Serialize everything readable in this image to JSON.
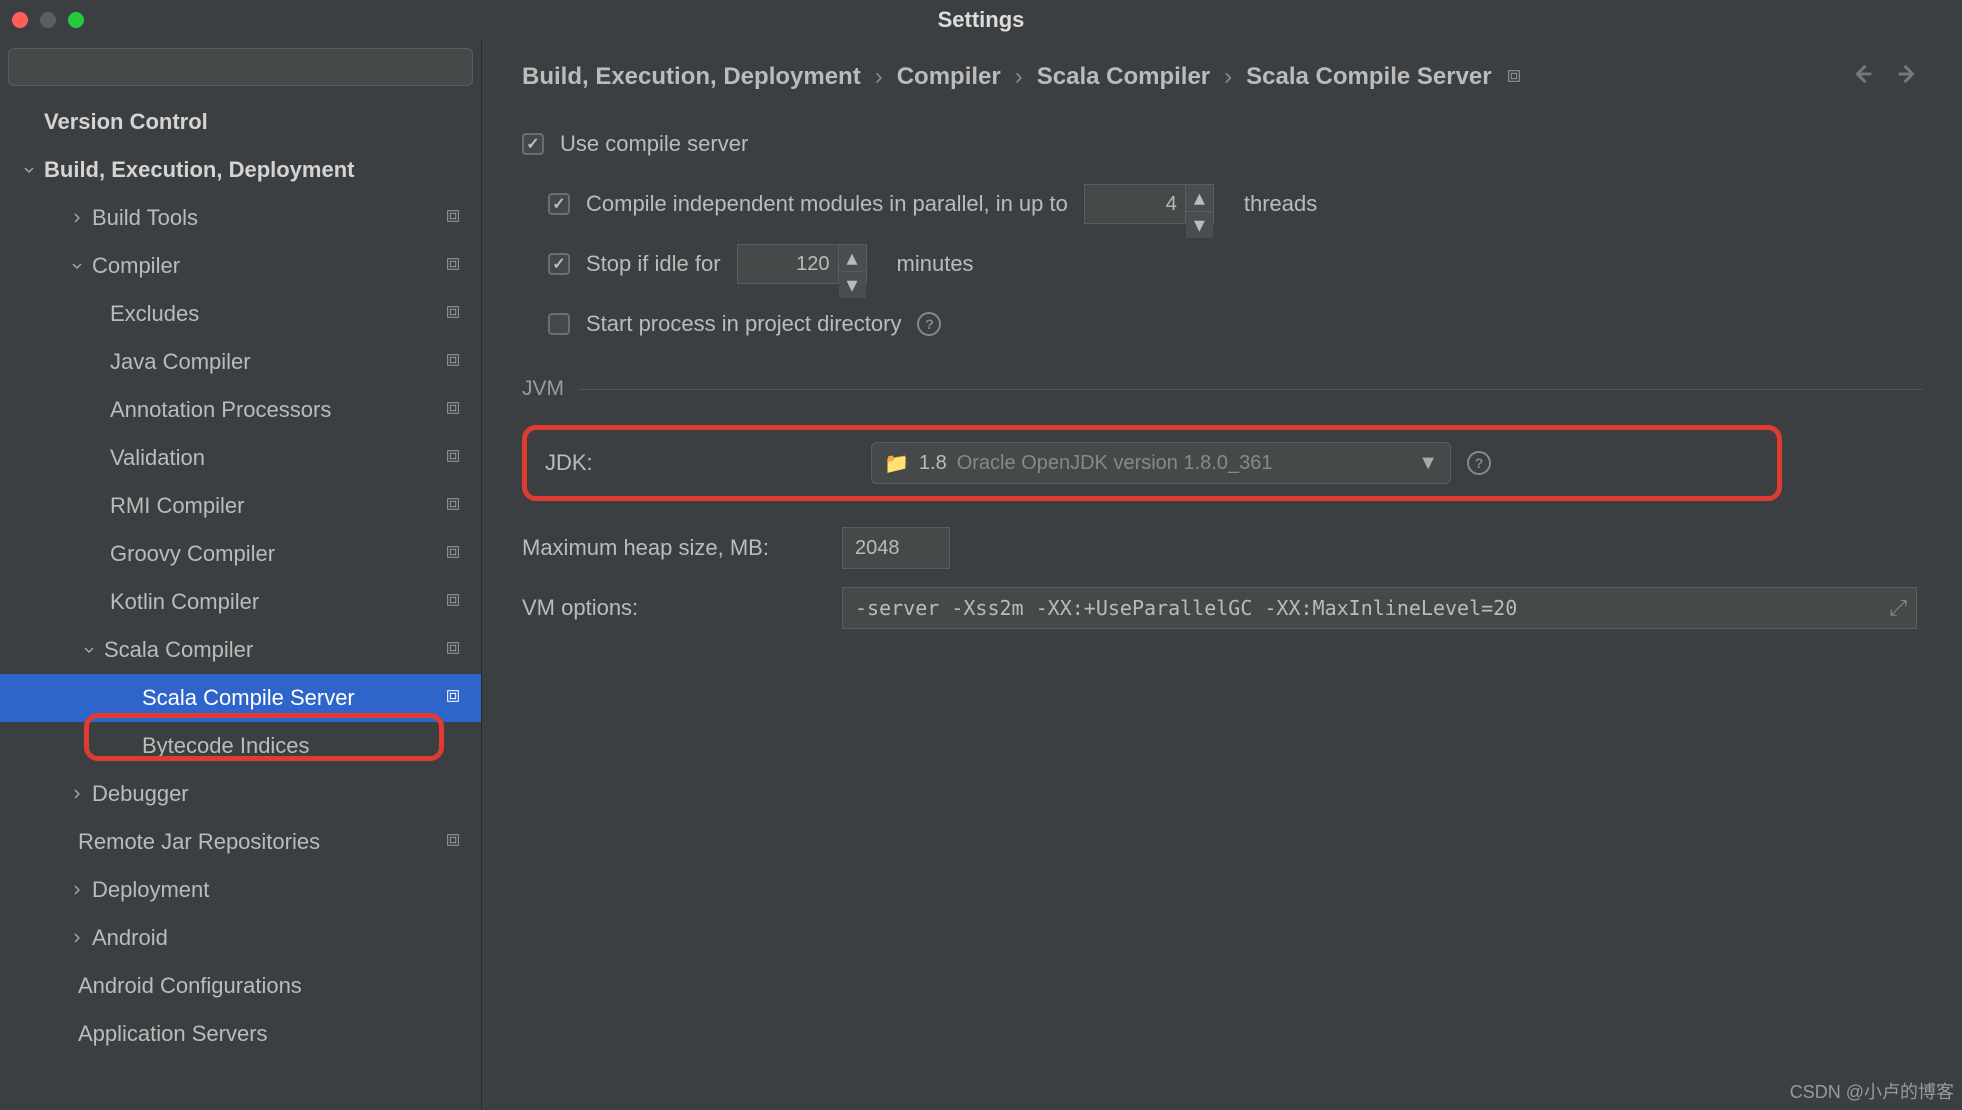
{
  "window": {
    "title": "Settings"
  },
  "search": {
    "placeholder": ""
  },
  "tree": {
    "version_control": "Version Control",
    "bed": "Build, Execution, Deployment",
    "build_tools": "Build Tools",
    "compiler": "Compiler",
    "excludes": "Excludes",
    "java_compiler": "Java Compiler",
    "annotation_processors": "Annotation Processors",
    "validation": "Validation",
    "rmi_compiler": "RMI Compiler",
    "groovy_compiler": "Groovy Compiler",
    "kotlin_compiler": "Kotlin Compiler",
    "scala_compiler": "Scala Compiler",
    "scala_compile_server": "Scala Compile Server",
    "bytecode_indices": "Bytecode Indices",
    "debugger": "Debugger",
    "remote_jar": "Remote Jar Repositories",
    "deployment": "Deployment",
    "android": "Android",
    "android_conf": "Android Configurations",
    "app_servers": "Application Servers"
  },
  "breadcrumb": {
    "a": "Build, Execution, Deployment",
    "b": "Compiler",
    "c": "Scala Compiler",
    "d": "Scala Compile Server"
  },
  "form": {
    "use_compile_server": "Use compile server",
    "parallel_label": "Compile independent modules in parallel, in up to",
    "parallel_value": "4",
    "threads": "threads",
    "stop_idle": "Stop if idle for",
    "stop_idle_value": "120",
    "minutes": "minutes",
    "start_in_project": "Start process in project directory",
    "jvm_section": "JVM",
    "jdk_label": "JDK:",
    "jdk_value": "1.8",
    "jdk_suffix": "Oracle OpenJDK version 1.8.0_361",
    "heap_label": "Maximum heap size, MB:",
    "heap_value": "2048",
    "vm_label": "VM options:",
    "vm_value": "-server -Xss2m -XX:+UseParallelGC -XX:MaxInlineLevel=20"
  },
  "watermark": "CSDN @小卢的博客"
}
